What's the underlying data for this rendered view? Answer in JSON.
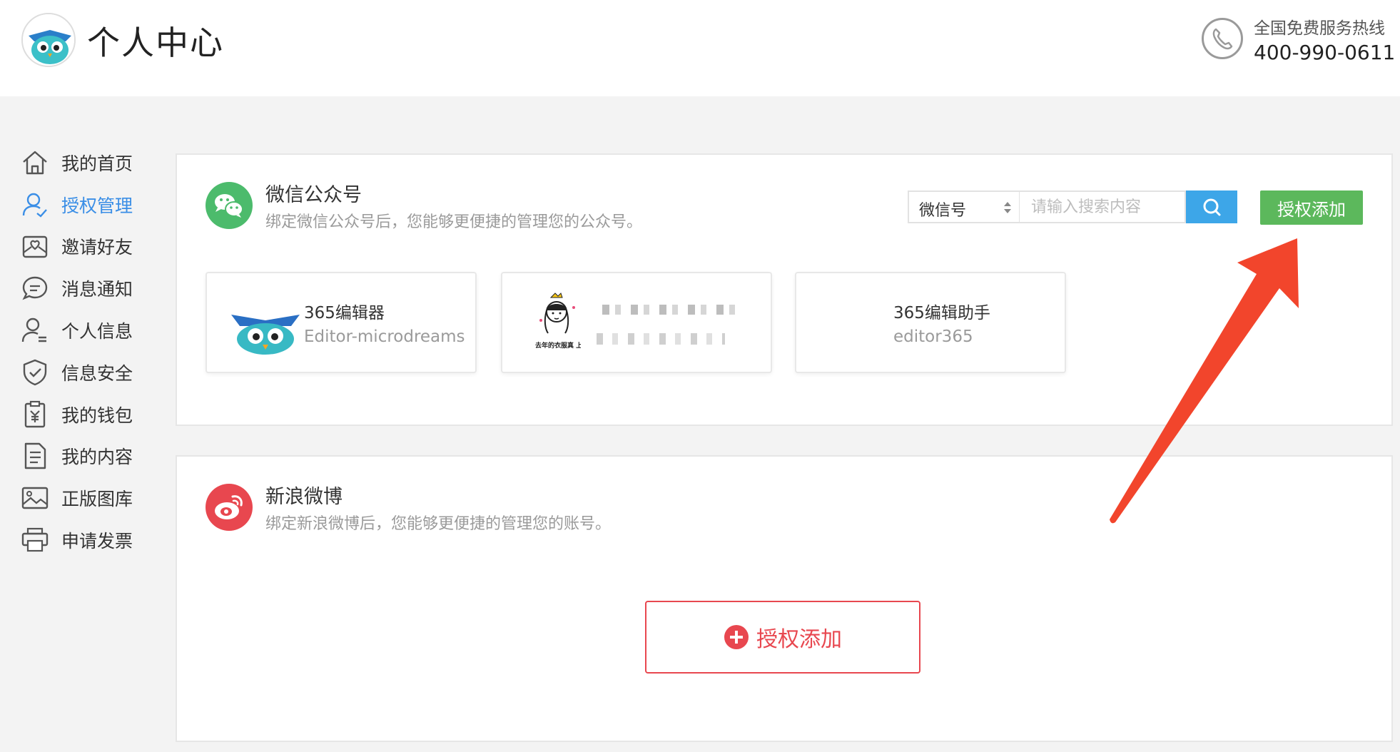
{
  "header": {
    "title": "个人中心",
    "hotline_label": "全国免费服务热线",
    "hotline_number": "400-990-0611"
  },
  "sidebar": {
    "items": [
      {
        "label": "我的首页",
        "icon": "home-icon"
      },
      {
        "label": "授权管理",
        "icon": "user-check-icon",
        "active": true
      },
      {
        "label": "邀请好友",
        "icon": "heart-envelope-icon"
      },
      {
        "label": "消息通知",
        "icon": "chat-bubble-icon"
      },
      {
        "label": "个人信息",
        "icon": "user-icon"
      },
      {
        "label": "信息安全",
        "icon": "shield-icon"
      },
      {
        "label": "我的钱包",
        "icon": "wallet-yen-icon"
      },
      {
        "label": "我的内容",
        "icon": "document-icon"
      },
      {
        "label": "正版图库",
        "icon": "image-icon"
      },
      {
        "label": "申请发票",
        "icon": "printer-icon"
      }
    ]
  },
  "wechat": {
    "title": "微信公众号",
    "description": "绑定微信公众号后，您能够更便捷的管理您的公众号。",
    "search_type": "微信号",
    "search_placeholder": "请输入搜索内容",
    "add_label": "授权添加",
    "accounts": [
      {
        "name": "365编辑器",
        "id": "Editor-microdreams"
      },
      {
        "name": "",
        "id": "",
        "image_caption": "去年的衣服真 上我今年的气"
      },
      {
        "name": "365编辑助手",
        "id": "editor365"
      }
    ]
  },
  "weibo": {
    "title": "新浪微博",
    "description": "绑定新浪微博后，您能够更便捷的管理您的账号。",
    "add_label": "授权添加"
  },
  "colors": {
    "active": "#3a8ee6",
    "green": "#5cb85c",
    "search_blue": "#3da6e8",
    "weibo_red": "#e8474f",
    "arrow": "#f2452c"
  }
}
